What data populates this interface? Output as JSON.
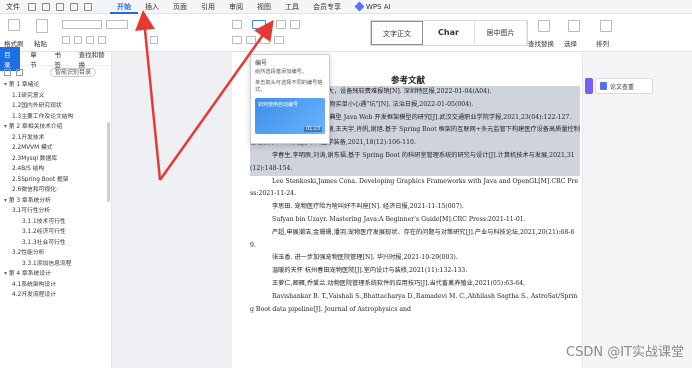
{
  "menubar": {
    "file_label": "文件",
    "tabs": [
      "开始",
      "插入",
      "页面",
      "引用",
      "审阅",
      "视图",
      "工具",
      "会员专享"
    ],
    "active_tab": "开始",
    "wps_ai_label": "WPS AI"
  },
  "ribbon": {
    "format_painter_label": "格式刷",
    "paste_label": "粘贴",
    "styles": [
      "文字正文",
      "Char",
      "居中图片"
    ],
    "find_replace_label": "查找替换",
    "select_label": "选择",
    "arrange_label": "排列"
  },
  "sidebar": {
    "tabs": [
      "目录",
      "章节",
      "书签",
      "查找和替换"
    ],
    "smart_button": "智能识别目录",
    "outline": [
      {
        "level": 1,
        "label": "第 1 章绪论"
      },
      {
        "level": 2,
        "label": "1.1研究意义"
      },
      {
        "level": 2,
        "label": "1.2国内外研究现状"
      },
      {
        "level": 2,
        "label": "1.3主要工作及论文结构"
      },
      {
        "level": 1,
        "label": "第 2 章相关技术介绍"
      },
      {
        "level": 2,
        "label": "2.1开发技术"
      },
      {
        "level": 2,
        "label": "2.2MVVM 模式"
      },
      {
        "level": 2,
        "label": "2.3Mysql 数据库"
      },
      {
        "level": 2,
        "label": "2.4B/S 结构"
      },
      {
        "level": 2,
        "label": "2.5Spring Boot 框架"
      },
      {
        "level": 2,
        "label": "2.6微信和可视化:"
      },
      {
        "level": 1,
        "label": "第 3 章系统分析"
      },
      {
        "level": 2,
        "label": "3.1可行性分析"
      },
      {
        "level": 3,
        "label": "3.1.1技术可行性"
      },
      {
        "level": 3,
        "label": "3.1.2经济可行性"
      },
      {
        "level": 3,
        "label": "3.1.3社会可行性"
      },
      {
        "level": 2,
        "label": "3.2性能分析"
      },
      {
        "level": 3,
        "label": "3.3.1添加信息流程"
      },
      {
        "level": 1,
        "label": "第 4 章系统设计"
      },
      {
        "level": 2,
        "label": "4.1系统架构设计"
      },
      {
        "level": 2,
        "label": "4.2开发流程设计"
      }
    ]
  },
  "popup": {
    "title": "编号",
    "desc1": "给所选段落添加编号。",
    "desc2": "单击箭头可选择不同的编号格式。",
    "video_label": "如何使用自动编号",
    "video_time": "01:23"
  },
  "document": {
    "title": "参考文献",
    "refs": [
      {
        "hl": true,
        "text": "…宠物诊疗价格差异大，设备残较费难报销[N]. 深圳特区报,2022-01-04(A04)."
      },
      {
        "hl": true,
        "text": "邱连勤, 杨思夫. 为宠物买单小心遇\"坑\"[N]. 法治日报,2022-01-05(004)."
      },
      {
        "hl": true,
        "text": "梁沛,张起,杨章如九. 典型 Java Web 开发框架模型的研究[J].武汉交通职业学院学报,2021,23(04):122-127."
      },
      {
        "hl": true,
        "text": "徐知,李明明,夏辉,陈曦,王天宇,肖帆,谢旭.基于 Spring Boot 框架的互联网+多元监管下构建医疗设备高质量控制管理服务平台研究[J].中国医学装备,2021,18(12):106-110."
      },
      {
        "hl": true,
        "text": "李春生,李明辰,刘涛,谢东福.基于 Spring Boot 的科研室管理系统的研究与设计[J].计算机技术与发展,2021,31(12):148-154."
      },
      {
        "hl": false,
        "text": "Lee Stenkoski,James Cona. Developing Graphics Frameworks with Java and OpenGL[M].CRC Press:2021-11-24."
      },
      {
        "hl": false,
        "text": "李思田. 宠物医疗险为啥叫好不叫座[N]. 经济日报,2021-11-15(007)."
      },
      {
        "hl": false,
        "text": "Sufyan bin Uzayr. Mastering Java:A Beginner's Guide[M].CRC Press:2021-11-01."
      },
      {
        "hl": false,
        "text": "严超,申展潮洁,金珊珊,潘羽.宠物医疗发展现状、存在的问题与对策研究[J].产业与科技论坛,2021,20(21):68-69."
      },
      {
        "hl": false,
        "text": "张玉香. 进一步加强宠物医院管理[N]. 华兴时报,2021-10-29(003)."
      },
      {
        "hl": false,
        "text": "温暖的天怀 杭州春田宠物医院[J].室内设计与装修,2021(11):132-133."
      },
      {
        "hl": false,
        "text": "王萝仁,卿雁,乔爱兰.动物医院管理系统软件的应用技巧[J].当代畜禽养殖业,2021(05):63-64."
      },
      {
        "hl": false,
        "text": "Ravishankar B. T.,Vaishali S.,Bhattacharya D.,Ramadevi M. C.,Abhilash Sagtha S.. AstroSat/Spring Boot data pipeline[J]. Journal of Astrophysics and"
      }
    ]
  },
  "right_panel": {
    "card_label": "论文查重"
  },
  "watermark": "CSDN @IT实战课堂"
}
